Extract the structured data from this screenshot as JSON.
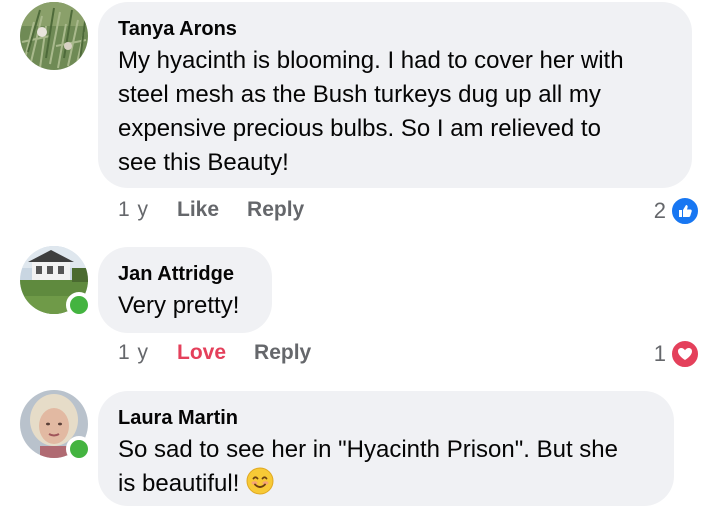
{
  "comments": [
    {
      "author": "Tanya Arons",
      "text_lines": [
        "My hyacinth is blooming.  I had to cover her with",
        "steel mesh as the Bush turkeys dug up all my",
        "expensive precious bulbs.  So I am relieved to",
        "see this Beauty!"
      ],
      "time": "1 y",
      "like_label": "Like",
      "reply_label": "Reply",
      "reaction_count": "2",
      "reaction_icon": "like-icon",
      "online": false
    },
    {
      "author": "Jan Attridge",
      "text_lines": [
        "Very pretty!"
      ],
      "time": "1 y",
      "like_label": "Love",
      "reply_label": "Reply",
      "reaction_count": "1",
      "reaction_icon": "heart-icon",
      "online": true
    },
    {
      "author": "Laura Martin",
      "text_lines": [
        "So sad to see her in \"Hyacinth Prison\". But she",
        "is beautiful!"
      ],
      "trailing_emoji": "smiling-face-emoji",
      "online": true
    }
  ],
  "colors": {
    "bubble": "#f0f1f4",
    "online": "#44b440",
    "like_blue": "#1877f2",
    "love_red": "#e4405b",
    "meta_gray": "#65676b"
  }
}
